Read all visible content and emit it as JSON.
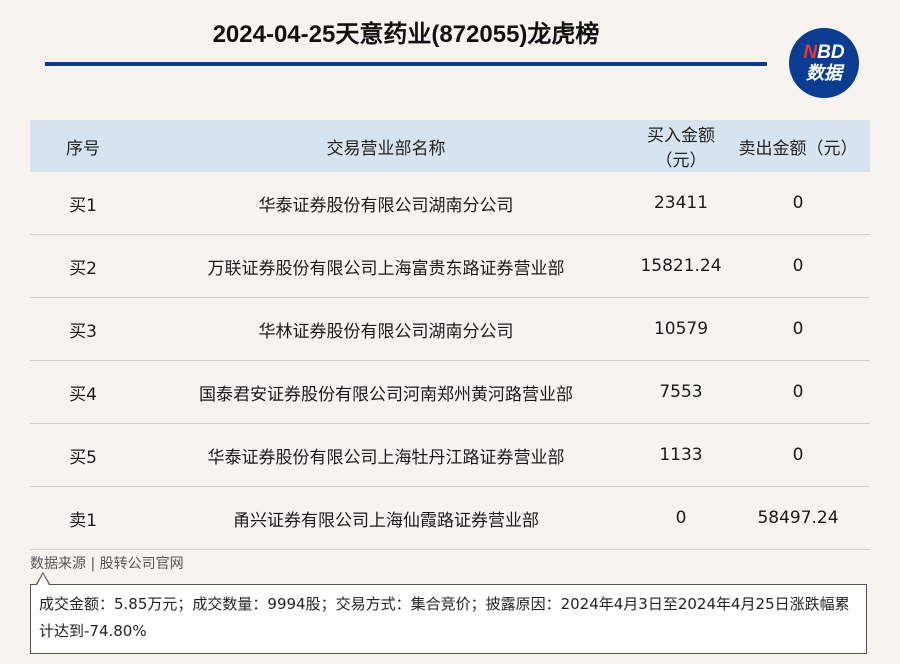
{
  "header": {
    "title": "2024-04-25天意药业(872055)龙虎榜",
    "logo_top": "NBD",
    "logo_top_n": "N",
    "logo_top_rest": "BD",
    "logo_bottom": "数据"
  },
  "table": {
    "columns": [
      "序号",
      "交易营业部名称",
      "买入金额（元）",
      "卖出金额（元）"
    ],
    "rows": [
      {
        "seq": "买1",
        "name": "华泰证券股份有限公司湖南分公司",
        "buy": "23411",
        "sell": "0"
      },
      {
        "seq": "买2",
        "name": "万联证券股份有限公司上海富贵东路证券营业部",
        "buy": "15821.24",
        "sell": "0"
      },
      {
        "seq": "买3",
        "name": "华林证券股份有限公司湖南分公司",
        "buy": "10579",
        "sell": "0"
      },
      {
        "seq": "买4",
        "name": "国泰君安证券股份有限公司河南郑州黄河路营业部",
        "buy": "7553",
        "sell": "0"
      },
      {
        "seq": "买5",
        "name": "华泰证券股份有限公司上海牡丹江路证券营业部",
        "buy": "1133",
        "sell": "0"
      },
      {
        "seq": "卖1",
        "name": "甬兴证券有限公司上海仙霞路证券营业部",
        "buy": "0",
        "sell": "58497.24"
      }
    ]
  },
  "footer": {
    "source": "数据来源 | 股转公司官网",
    "note": "成交金额：5.85万元；成交数量：9994股；交易方式：集合竞价；披露原因：2024年4月3日至2024年4月25日涨跌幅累计达到-74.80%"
  },
  "colors": {
    "accent": "#0a3d91",
    "header_bg": "#d6e4ef",
    "page_bg": "#f7f4f0",
    "logo_n": "#e53935"
  },
  "icons": [
    "nbd-logo"
  ]
}
